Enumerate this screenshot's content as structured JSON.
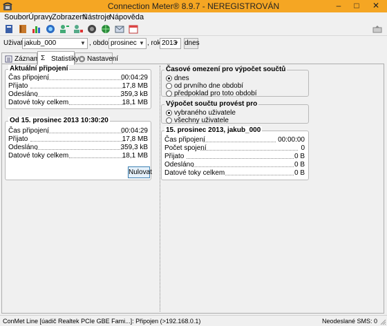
{
  "window": {
    "title": "Connection Meter® 8.9.7 - NEREGISTROVÁN",
    "controls": {
      "minimize": "–",
      "maximize": "□",
      "close": "✕"
    }
  },
  "menu": [
    "Soubor",
    "Úpravy",
    "Zobrazení",
    "Nástroje",
    "Nápověda"
  ],
  "toolbar_icons": [
    "book-icon",
    "address-book-icon",
    "bar-chart-icon",
    "refresh-icon",
    "user-add-icon",
    "user-remove-icon",
    "disconnect-icon",
    "globe-icon",
    "email-icon",
    "calendar-icon",
    "collapse-icon"
  ],
  "filter": {
    "user_label": "Uživatel",
    "user_value": "jakub_000",
    "period_label": ", období",
    "period_value": "prosinec",
    "year_label": ", rok",
    "year_value": "2013",
    "today_button": "dnes"
  },
  "tabs": [
    {
      "label": "Záznamy",
      "icon": "records-icon"
    },
    {
      "label": "Statistiky",
      "icon": "sigma-icon"
    },
    {
      "label": "Nastavení",
      "icon": "settings-icon"
    }
  ],
  "current_connection": {
    "title": "Aktuální připojení",
    "rows": [
      {
        "label": "Čas připojení",
        "value": "00:04:29"
      },
      {
        "label": "Přijato",
        "value": "17,8 MB"
      },
      {
        "label": "Odesláno",
        "value": "359,3 kB"
      },
      {
        "label": "Datové toky celkem",
        "value": "18,1 MB"
      }
    ]
  },
  "since": {
    "title": "Od 15. prosinec 2013 10:30:20",
    "rows": [
      {
        "label": "Čas připojení",
        "value": "00:04:29"
      },
      {
        "label": "Přijato",
        "value": "17,8 MB"
      },
      {
        "label": "Odesláno",
        "value": "359,3 kB"
      },
      {
        "label": "Datové toky celkem",
        "value": "18,1 MB"
      }
    ],
    "reset_button": "Nulovat"
  },
  "time_limit": {
    "title": "Časové omezení pro výpočet součtů",
    "options": [
      "dnes",
      "od prvního dne období",
      "předpoklad pro toto období"
    ],
    "selected": 0
  },
  "compute_for": {
    "title": "Výpočet součtu provést pro",
    "options": [
      "vybraného uživatele",
      "všechny uživatele"
    ],
    "selected": 0
  },
  "summary": {
    "title": "15. prosinec 2013, jakub_000",
    "rows": [
      {
        "label": "Čas připojení",
        "value": "00:00:00"
      },
      {
        "label": "Počet spojení",
        "value": "0"
      },
      {
        "label": "Přijato",
        "value": "0 B"
      },
      {
        "label": "Odesláno",
        "value": "0 B"
      },
      {
        "label": "Datové toky celkem",
        "value": "0 B"
      }
    ]
  },
  "status": {
    "left": "ConMet Line [úadič Realtek PCIe GBE Fami...]: Připojen (>192.168.0.1)",
    "right": "Neodeslané SMS: 0"
  }
}
